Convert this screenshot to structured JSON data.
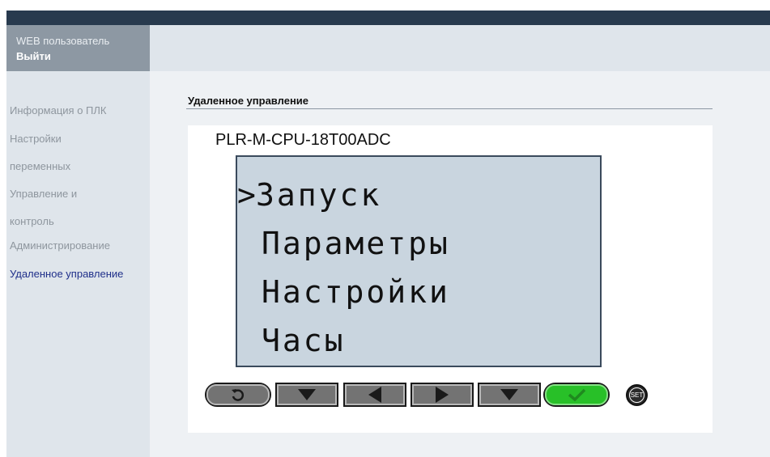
{
  "user": {
    "label": "WEB пользователь",
    "logout": "Выйти"
  },
  "sidebar": {
    "items": [
      {
        "label": "Информация о ПЛК"
      },
      {
        "label": "Настройки"
      },
      {
        "label": "переменных"
      },
      {
        "label": "Управление и"
      },
      {
        "label": "контроль"
      },
      {
        "label": "Администрирование"
      },
      {
        "label": "Удаленное управление",
        "active": true
      }
    ]
  },
  "main": {
    "title": "Удаленное управление",
    "device_model": "PLR-M-CPU-18T00ADC",
    "lcd": {
      "cursor": ">",
      "lines": [
        "Запуск",
        "Параметры",
        "Настройки",
        "Часы"
      ],
      "selected_index": 0
    },
    "buttons": {
      "back_icon": "undo-arrow-icon",
      "down_icon": "triangle-down-icon",
      "left_icon": "triangle-left-icon",
      "right_icon": "triangle-right-icon",
      "ok_icon": "check-icon",
      "set_label": "SET"
    }
  },
  "colors": {
    "topbar": "#283a4e",
    "sidebar_bg": "#dfe5eb",
    "nav_text": "#8e969e",
    "nav_active": "#1f2f8a",
    "lcd_bg": "#c9d5df",
    "ok_button": "#28c028"
  }
}
